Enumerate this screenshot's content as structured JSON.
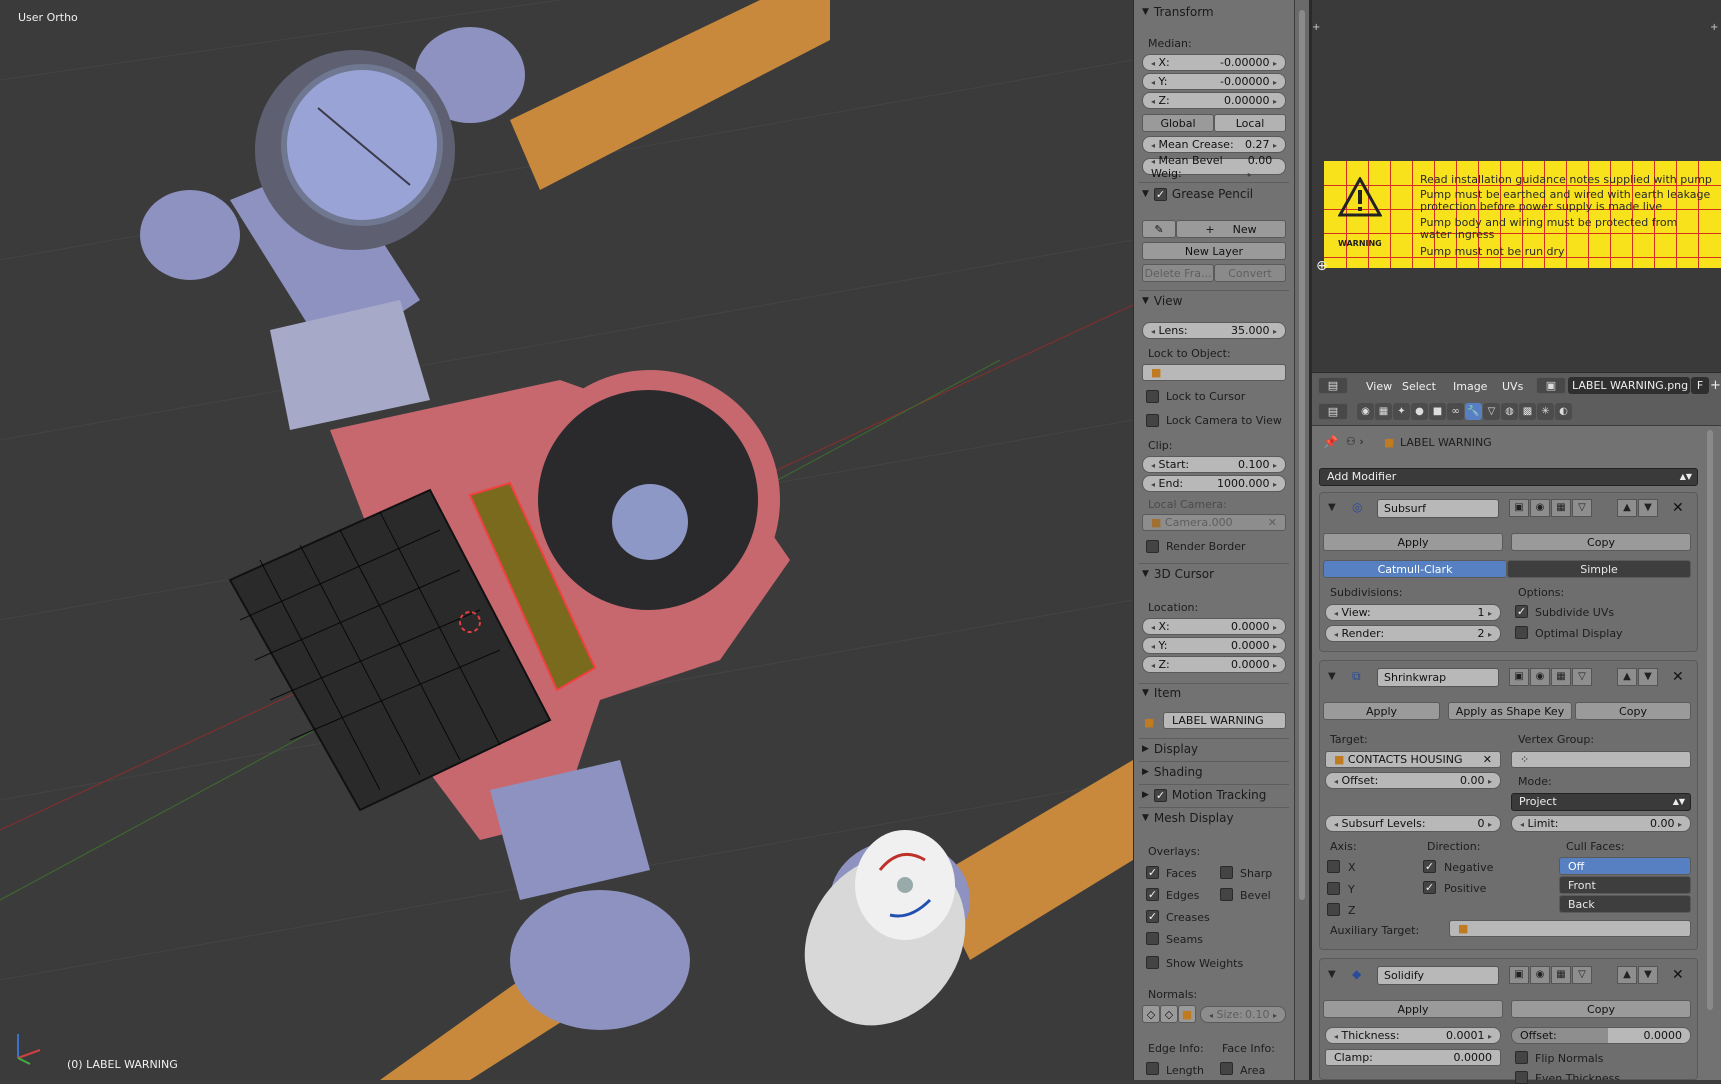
{
  "viewport": {
    "title": "User Ortho",
    "object_label": "(0) LABEL WARNING"
  },
  "npanel": {
    "transform": {
      "header": "Transform",
      "median_label": "Median:",
      "x": {
        "label": "X:",
        "value": "-0.00000"
      },
      "y": {
        "label": "Y:",
        "value": "-0.00000"
      },
      "z": {
        "label": "Z:",
        "value": "0.00000"
      },
      "global": "Global",
      "local": "Local",
      "mean_crease": {
        "label": "Mean Crease:",
        "value": "0.27"
      },
      "mean_bevel": {
        "label": "Mean Bevel Weig:",
        "value": "0.00"
      }
    },
    "grease_pencil": {
      "header": "Grease Pencil",
      "new": "New",
      "new_layer": "New Layer",
      "delete_frame": "Delete Fra...",
      "convert": "Convert"
    },
    "view": {
      "header": "View",
      "lens": {
        "label": "Lens:",
        "value": "35.000"
      },
      "lock_to_object": "Lock to Object:",
      "lock_to_cursor": "Lock to Cursor",
      "lock_camera": "Lock Camera to View",
      "clip": "Clip:",
      "start": {
        "label": "Start:",
        "value": "0.100"
      },
      "end": {
        "label": "End:",
        "value": "1000.000"
      },
      "local_camera": "Local Camera:",
      "camera_value": "Camera.000",
      "render_border": "Render Border"
    },
    "cursor": {
      "header": "3D Cursor",
      "location": "Location:",
      "x": {
        "label": "X:",
        "value": "0.0000"
      },
      "y": {
        "label": "Y:",
        "value": "0.0000"
      },
      "z": {
        "label": "Z:",
        "value": "0.0000"
      }
    },
    "item": {
      "header": "Item",
      "name": "LABEL WARNING"
    },
    "display": {
      "header": "Display"
    },
    "shading": {
      "header": "Shading"
    },
    "motion_tracking": {
      "header": "Motion Tracking"
    },
    "mesh_display": {
      "header": "Mesh Display",
      "overlays": "Overlays:",
      "faces": "Faces",
      "sharp": "Sharp",
      "edges": "Edges",
      "bevel": "Bevel",
      "creases": "Creases",
      "seams": "Seams",
      "show_weights": "Show Weights",
      "normals": "Normals:",
      "size": {
        "label": "Size:",
        "value": "0.10"
      },
      "edge_info": "Edge Info:",
      "face_info": "Face Info:",
      "length": "Length",
      "area": "Area"
    }
  },
  "image_editor": {
    "label_lines": [
      "Read installation guidance notes supplied with pump",
      "Pump must be earthed and wired with earth leakage",
      "protection before power supply is made live",
      "Pump body and wiring must be protected from",
      "water ingress",
      "Pump must not be run dry"
    ],
    "warning_text": "WARNING",
    "menus": [
      "View",
      "Select",
      "Image",
      "UVs"
    ],
    "image_name": "LABEL WARNING.png",
    "f_button": "F"
  },
  "properties": {
    "breadcrumb": "LABEL WARNING",
    "add_modifier": "Add Modifier",
    "subsurf": {
      "name": "Subsurf",
      "apply": "Apply",
      "copy": "Copy",
      "catmull": "Catmull-Clark",
      "simple": "Simple",
      "subdivisions": "Subdivisions:",
      "options": "Options:",
      "view": {
        "label": "View:",
        "value": "1"
      },
      "render": {
        "label": "Render:",
        "value": "2"
      },
      "subdivide_uvs": "Subdivide UVs",
      "optimal_display": "Optimal Display"
    },
    "shrinkwrap": {
      "name": "Shrinkwrap",
      "apply": "Apply",
      "apply_shape": "Apply as Shape Key",
      "copy": "Copy",
      "target": "Target:",
      "target_value": "CONTACTS HOUSING",
      "vertex_group": "Vertex Group:",
      "offset": {
        "label": "Offset:",
        "value": "0.00"
      },
      "mode": "Mode:",
      "mode_value": "Project",
      "subsurf_levels": {
        "label": "Subsurf Levels:",
        "value": "0"
      },
      "limit": {
        "label": "Limit:",
        "value": "0.00"
      },
      "axis": "Axis:",
      "direction": "Direction:",
      "cull_faces": "Cull Faces:",
      "x": "X",
      "y": "Y",
      "z": "Z",
      "negative": "Negative",
      "positive": "Positive",
      "cull_options": [
        "Off",
        "Front",
        "Back"
      ],
      "auxiliary": "Auxiliary Target:"
    },
    "solidify": {
      "name": "Solidify",
      "apply": "Apply",
      "copy": "Copy",
      "thickness": {
        "label": "Thickness:",
        "value": "0.0001"
      },
      "offset": {
        "label": "Offset:",
        "value": "0.0000"
      },
      "clamp": {
        "label": "Clamp:",
        "value": "0.0000"
      },
      "flip_normals": "Flip Normals",
      "even_thickness": "Even Thickness"
    }
  }
}
